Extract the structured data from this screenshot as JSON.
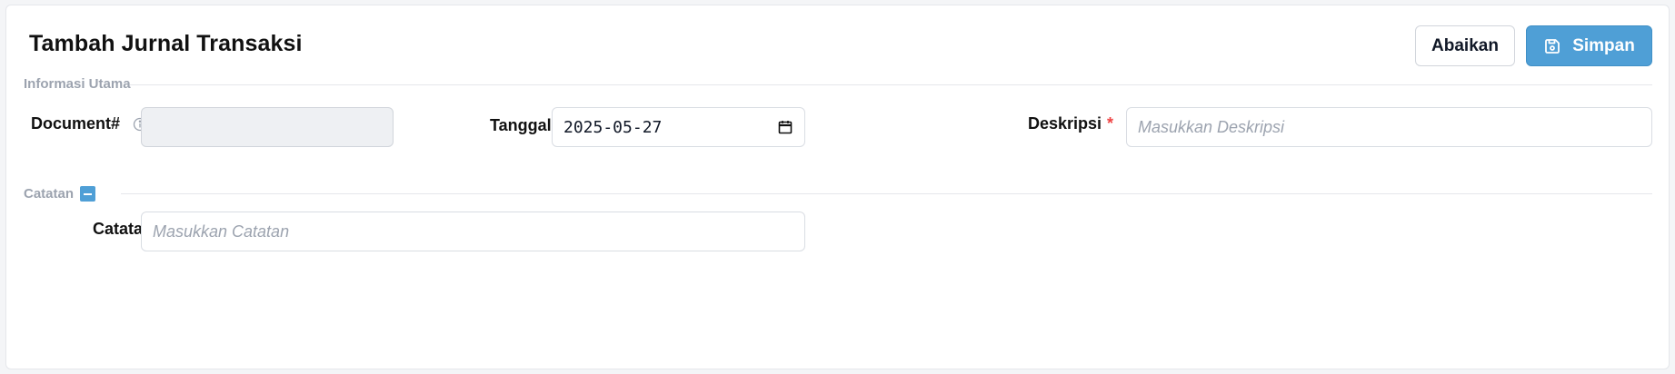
{
  "header": {
    "title": "Tambah Jurnal Transaksi",
    "cancel_label": "Abaikan",
    "save_label": "Simpan"
  },
  "sections": {
    "main": {
      "label": "Informasi Utama"
    },
    "notes": {
      "label": "Catatan",
      "toggle_icon": "collapse-minus-icon"
    }
  },
  "fields": {
    "document": {
      "label": "Document#",
      "value": "",
      "placeholder": ""
    },
    "date": {
      "label": "Tanggal",
      "required_mark": "*",
      "value": "2025-05-27"
    },
    "description": {
      "label": "Deskripsi",
      "required_mark": "*",
      "value": "",
      "placeholder": "Masukkan Deskripsi"
    },
    "notes": {
      "label": "Catatan",
      "value": "",
      "placeholder": "Masukkan Catatan"
    }
  },
  "icons": {
    "save": "save-icon",
    "info": "info-icon",
    "calendar": "calendar-icon"
  },
  "colors": {
    "accent": "#4f9fd6",
    "required": "#ef4444",
    "muted": "#9ca3af"
  }
}
